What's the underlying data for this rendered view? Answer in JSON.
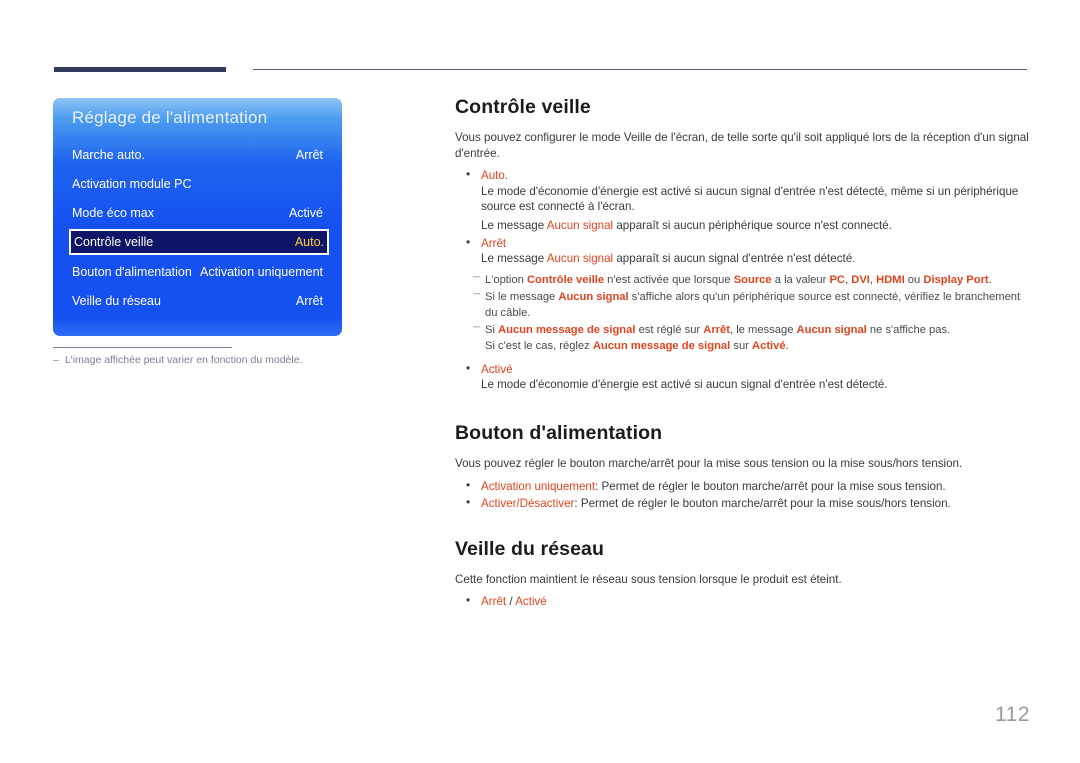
{
  "page": {
    "number": "112",
    "accent_color": "#e0441f",
    "header_bar_color": "#333a5c"
  },
  "osd": {
    "title": "Réglage de l'alimentation",
    "rows": [
      {
        "label": "Marche auto.",
        "value": "Arrêt",
        "selected": false
      },
      {
        "label": "Activation module PC",
        "value": "",
        "selected": false
      },
      {
        "label": "Mode éco max",
        "value": "Activé",
        "selected": false
      },
      {
        "label": "Contrôle veille",
        "value": "Auto.",
        "selected": true
      },
      {
        "label": "Bouton d'alimentation",
        "value": "Activation uniquement",
        "selected": false
      },
      {
        "label": "Veille du réseau",
        "value": "Arrêt",
        "selected": false
      }
    ],
    "caption_dash": "–",
    "caption": "L'image affichée peut varier en fonction du modèle."
  },
  "sections": {
    "standby": {
      "title": "Contrôle veille",
      "intro": "Vous pouvez configurer le mode Veille de l'écran, de telle sorte qu'il soit appliqué lors de la réception d'un signal d'entrée.",
      "bullets": [
        {
          "head": "Auto.",
          "lines": [
            "Le mode d'économie d'énergie est activé si aucun signal d'entrée n'est détecté, même si un périphérique source est connecté à l'écran.",
            "Le message Aucun signal apparaît si aucun périphérique source n'est connecté."
          ]
        },
        {
          "head": "Arrêt",
          "lines": [
            "Le message Aucun signal apparaît si aucun signal d'entrée n'est détecté."
          ]
        }
      ],
      "notes": [
        "L'option Contrôle veille n'est activée que lorsque Source a la valeur PC, DVI, HDMI ou Display Port.",
        "Si le message Aucun signal s'affiche alors qu'un périphérique source est connecté, vérifiez le branchement du câble.",
        "Si Aucun message de signal est réglé sur Arrêt, le message Aucun signal ne s'affiche pas. Si c'est le cas, réglez Aucun message de signal sur Activé."
      ],
      "bullet_last": {
        "head": "Activé",
        "lines": [
          "Le mode d'économie d'énergie est activé si aucun signal d'entrée n'est détecté."
        ]
      }
    },
    "power_button": {
      "title": "Bouton d'alimentation",
      "intro": "Vous pouvez régler le bouton marche/arrêt pour la mise sous tension ou la mise sous/hors tension.",
      "bullets": [
        {
          "head": "Activation uniquement",
          "rest": ": Permet de régler le bouton marche/arrêt pour la mise sous tension."
        },
        {
          "head": "Activer/Désactiver",
          "rest": ": Permet de régler le bouton marche/arrêt pour la mise sous/hors tension."
        }
      ]
    },
    "network_standby": {
      "title": "Veille du réseau",
      "intro": "Cette fonction maintient le réseau sous tension lorsque le produit est éteint.",
      "options": {
        "off": "Arrêt",
        "separator": "/",
        "on": "Activé"
      }
    }
  },
  "inline_terms": {
    "aucun_signal": "Aucun signal",
    "controle_veille": "Contrôle veille",
    "source": "Source",
    "pc": "PC",
    "dvi": "DVI",
    "hdmi": "HDMI",
    "display_port": "Display Port",
    "aucun_message_de_signal": "Aucun message de signal",
    "arret": "Arrêt",
    "active": "Activé"
  }
}
